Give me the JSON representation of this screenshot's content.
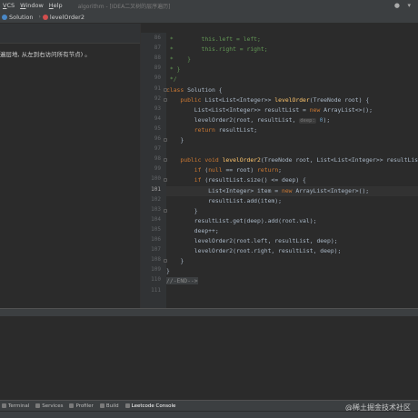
{
  "menubar": {
    "items": [
      {
        "label": "VCS",
        "u": "V",
        "rest": "CS"
      },
      {
        "label": "Window",
        "u": "W",
        "rest": "indow"
      },
      {
        "label": "Help",
        "u": "H",
        "rest": "elp"
      }
    ],
    "window_title": "algorithm - [IDEA二叉树的层序遍历]",
    "user_icon": "user-icon"
  },
  "breadcrumbs": [
    {
      "icon": "class-icon",
      "label": "Solution"
    },
    {
      "icon": "method-icon",
      "label": "levelOrder2"
    }
  ],
  "description": {
    "text": "遍层地, 从左到右访问所有节点) 。"
  },
  "code": {
    "lines": [
      {
        "n": "86",
        "tokens": [
          [
            "cm",
            " *        this.left = left;"
          ]
        ]
      },
      {
        "n": "87",
        "tokens": [
          [
            "cm",
            " *        this.right = right;"
          ]
        ]
      },
      {
        "n": "88",
        "tokens": [
          [
            "cm",
            " *    }"
          ]
        ]
      },
      {
        "n": "89",
        "tokens": [
          [
            "cm",
            " * }"
          ]
        ]
      },
      {
        "n": "90",
        "tokens": [
          [
            "cm",
            " */"
          ]
        ]
      },
      {
        "n": "91",
        "tokens": [
          [
            "kw",
            "class "
          ],
          [
            "pl",
            "Solution {"
          ]
        ]
      },
      {
        "n": "92",
        "tokens": [
          [
            "pl",
            "    "
          ],
          [
            "kw",
            "public "
          ],
          [
            "pl",
            "List<List<Integer>> "
          ],
          [
            "fn",
            "levelOrder"
          ],
          [
            "pl",
            "(TreeNode root) {"
          ]
        ]
      },
      {
        "n": "93",
        "tokens": [
          [
            "pl",
            "        List<List<Integer>> resultList = "
          ],
          [
            "kw",
            "new "
          ],
          [
            "pl",
            "ArrayList<>();"
          ]
        ]
      },
      {
        "n": "94",
        "tokens": [
          [
            "pl",
            "        levelOrder2(root, resultList, "
          ],
          [
            "hint",
            "deep:"
          ],
          [
            "nm",
            " 0"
          ],
          [
            "pl",
            ");"
          ]
        ]
      },
      {
        "n": "95",
        "tokens": [
          [
            "pl",
            "        "
          ],
          [
            "kw",
            "return "
          ],
          [
            "pl",
            "resultList;"
          ]
        ]
      },
      {
        "n": "96",
        "tokens": [
          [
            "pl",
            "    }"
          ]
        ]
      },
      {
        "n": "97",
        "tokens": []
      },
      {
        "n": "98",
        "tokens": [
          [
            "pl",
            "    "
          ],
          [
            "kw",
            "public void "
          ],
          [
            "fn",
            "levelOrder2"
          ],
          [
            "pl",
            "(TreeNode root, List<List<Integer>> resultList, In"
          ]
        ]
      },
      {
        "n": "99",
        "tokens": [
          [
            "pl",
            "        "
          ],
          [
            "kw",
            "if "
          ],
          [
            "pl",
            "("
          ],
          [
            "kw",
            "null "
          ],
          [
            "pl",
            "== root) "
          ],
          [
            "kw",
            "return"
          ],
          [
            "pl",
            ";"
          ]
        ]
      },
      {
        "n": "100",
        "tokens": [
          [
            "pl",
            "        "
          ],
          [
            "kw",
            "if "
          ],
          [
            "pl",
            "(resultList.size() <= deep) {"
          ]
        ]
      },
      {
        "n": "101",
        "cur": true,
        "tokens": [
          [
            "pl",
            "            List<Integer> item = "
          ],
          [
            "kw",
            "new "
          ],
          [
            "pl",
            "ArrayList<Integer>();"
          ]
        ]
      },
      {
        "n": "102",
        "tokens": [
          [
            "pl",
            "            resultList.add(item);"
          ]
        ]
      },
      {
        "n": "103",
        "tokens": [
          [
            "pl",
            "        }"
          ]
        ]
      },
      {
        "n": "104",
        "tokens": [
          [
            "pl",
            "        resultList.get(deep).add(root.val);"
          ]
        ]
      },
      {
        "n": "105",
        "tokens": [
          [
            "pl",
            "        deep++;"
          ]
        ]
      },
      {
        "n": "106",
        "tokens": [
          [
            "pl",
            "        levelOrder2(root.left, resultList, deep);"
          ]
        ]
      },
      {
        "n": "107",
        "tokens": [
          [
            "pl",
            "        levelOrder2(root.right, resultList, deep);"
          ]
        ]
      },
      {
        "n": "108",
        "tokens": [
          [
            "pl",
            "    }"
          ]
        ]
      },
      {
        "n": "109",
        "tokens": [
          [
            "pl",
            "}"
          ]
        ]
      },
      {
        "n": "110",
        "tokens": [
          [
            "endm",
            "//-END-->"
          ]
        ]
      },
      {
        "n": "111",
        "tokens": []
      }
    ]
  },
  "toolwindows": [
    {
      "label": "Terminal",
      "icon": "terminal-icon"
    },
    {
      "label": "Services",
      "icon": "services-icon"
    },
    {
      "label": "Profiler",
      "icon": "profiler-icon"
    },
    {
      "label": "Build",
      "icon": "build-icon"
    },
    {
      "label": "Leetcode Console",
      "icon": "leetcode-icon",
      "active": true
    }
  ],
  "watermark": "@稀土掘金技术社区",
  "colors": {
    "keyword": "#cc7832",
    "comment": "#629755",
    "function": "#ffc66d",
    "number": "#6897bb",
    "text": "#a9b7c6"
  }
}
